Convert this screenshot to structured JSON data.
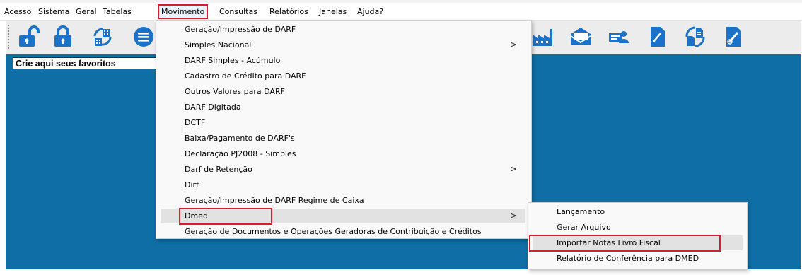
{
  "menubar": {
    "items": [
      "Acesso",
      "Sistema",
      "Geral",
      "Tabelas",
      "Movimento",
      "Consultas",
      "Relatórios",
      "Janelas",
      "Ajuda?"
    ]
  },
  "favorites": {
    "label": "Crie aqui seus favoritos"
  },
  "movimento_menu": {
    "items": [
      "Geração/Impressão de DARF",
      "Simples Nacional",
      "DARF Simples - Acúmulo",
      "Cadastro de Crédito para DARF",
      "Outros Valores para DARF",
      "DARF Digitada",
      "DCTF",
      "Baixa/Pagamento de DARF's",
      "Declaração PJ2008 - Simples",
      "Darf de Retenção",
      "Dirf",
      "Geração/Impressão de DARF Regime de Caixa",
      "Dmed",
      "Geração de Documentos e Operações Geradoras de Contribuição e Créditos"
    ],
    "submenu_arrow": ">"
  },
  "dmed_submenu": {
    "items": [
      "Lançamento",
      "Gerar Arquivo",
      "Importar Notas Livro Fiscal",
      "Relatório de Conferência para DMED"
    ]
  },
  "colors": {
    "accent": "#1a73c8",
    "background": "#0f6ea6",
    "highlight": "#d2202f"
  },
  "toolbar_icons": [
    "unlock-icon",
    "lock-icon",
    "buildings-sync-icon",
    "menu-circle-icon",
    "factory-icon",
    "mail-icon",
    "users-icon",
    "document-icon",
    "document-sync-icon",
    "document-link-icon"
  ]
}
